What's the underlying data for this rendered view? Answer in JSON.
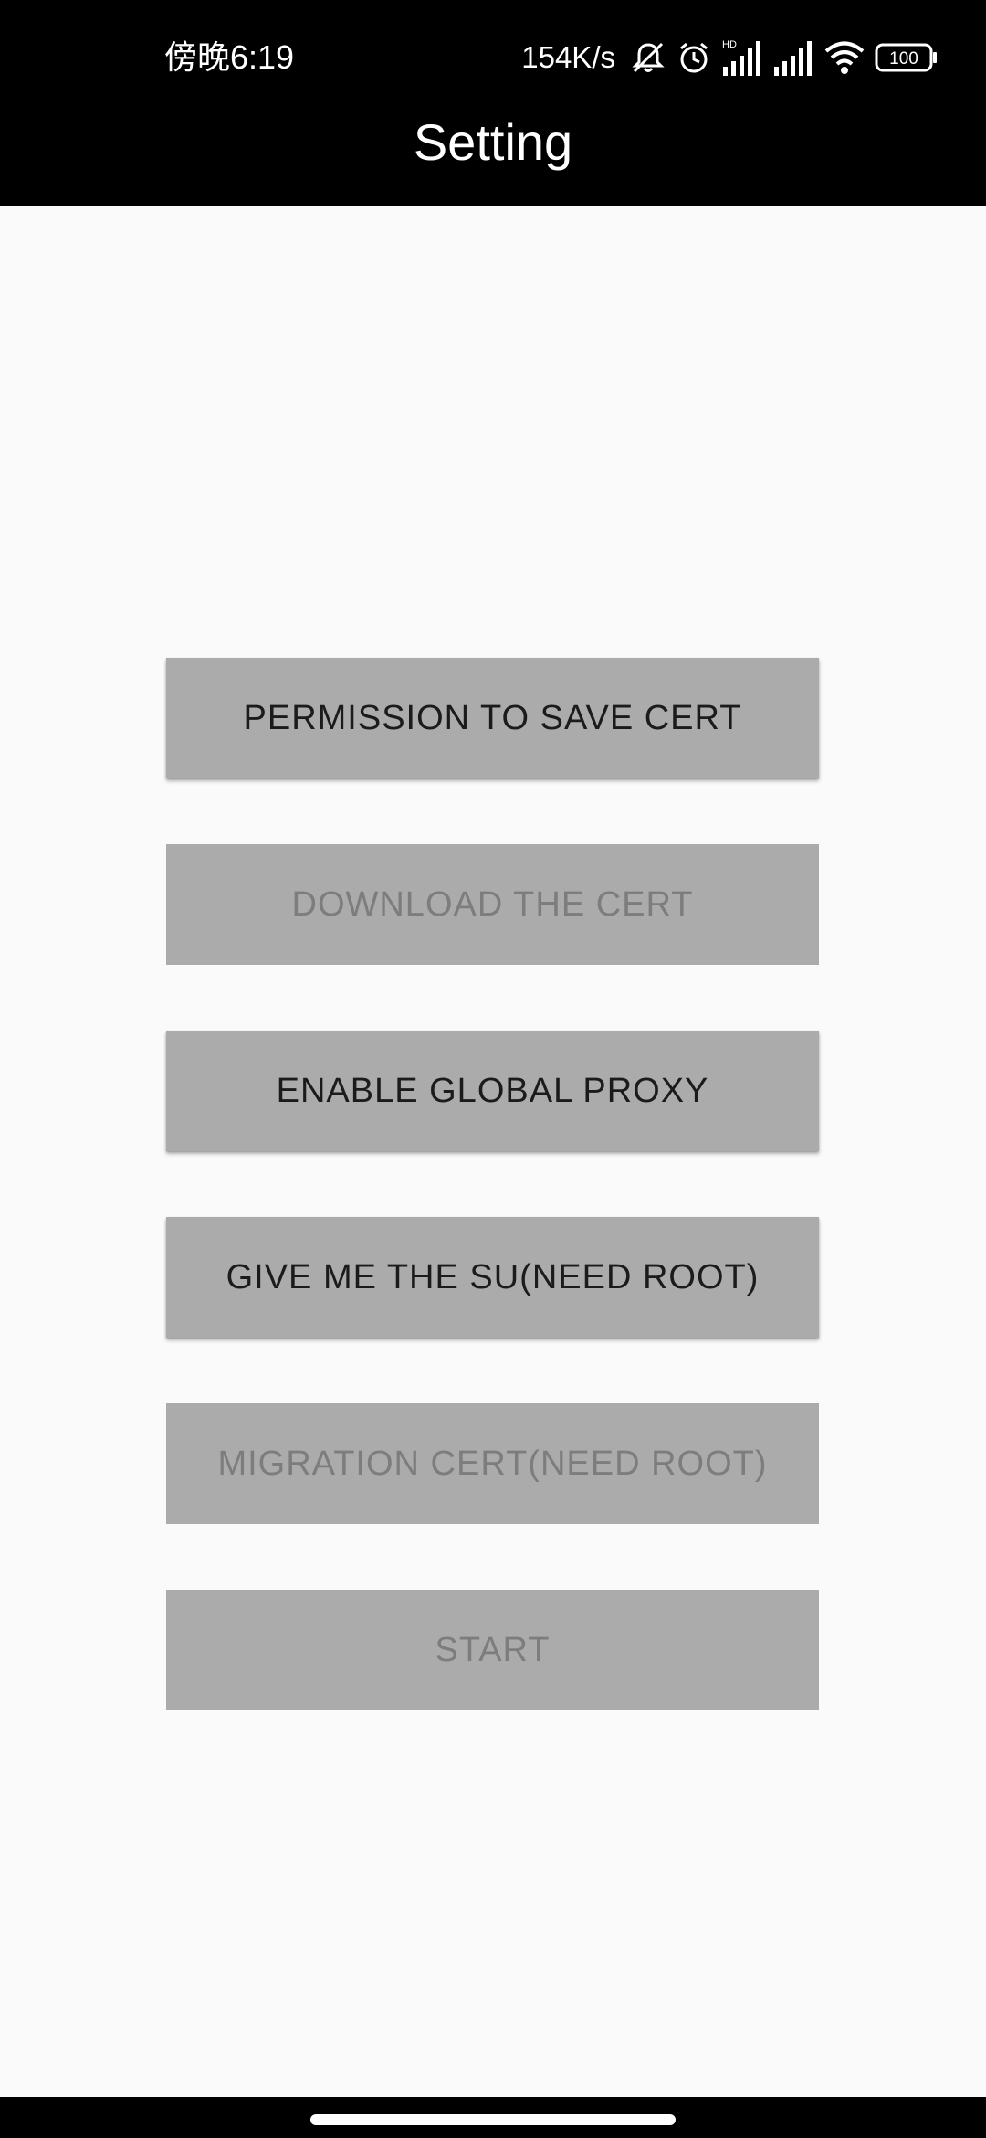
{
  "status_bar": {
    "time": "傍晚6:19",
    "net_speed": "154K/s",
    "icons": [
      "mute-icon",
      "alarm-icon",
      "hd-signal-icon",
      "signal-icon",
      "wifi-icon",
      "battery-icon"
    ],
    "signal_label": "HD",
    "battery_level": "100"
  },
  "app_bar": {
    "title": "Setting"
  },
  "buttons": [
    {
      "label": "PERMISSION TO SAVE CERT",
      "enabled": true
    },
    {
      "label": "DOWNLOAD THE CERT",
      "enabled": false
    },
    {
      "label": "ENABLE GLOBAL PROXY",
      "enabled": true
    },
    {
      "label": "GIVE ME THE SU(NEED ROOT)",
      "enabled": true
    },
    {
      "label": "MIGRATION CERT(NEED ROOT)",
      "enabled": false
    },
    {
      "label": "START",
      "enabled": false
    }
  ],
  "colors": {
    "header_bg": "#000000",
    "page_bg": "#fafafa",
    "button_bg": "#ababab",
    "button_text_enabled": "#1b1b1b",
    "button_text_disabled": "#7d7d7d"
  }
}
